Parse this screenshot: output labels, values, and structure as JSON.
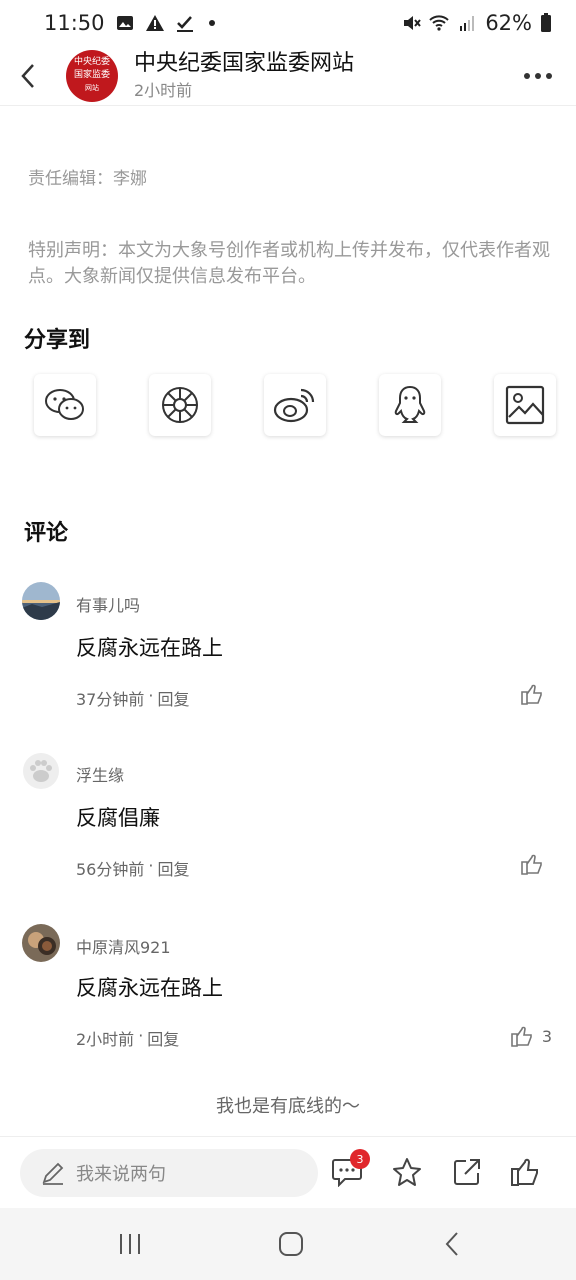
{
  "status_bar": {
    "time": "11:50",
    "battery": "62%"
  },
  "header": {
    "title": "中央纪委国家监委网站",
    "time": "2小时前",
    "logo_text": [
      "中央纪委",
      "国家监委",
      "网站"
    ]
  },
  "article": {
    "editor": "责任编辑：李娜",
    "disclaimer": "特别声明：本文为大象号创作者或机构上传并发布，仅代表作者观点。大象新闻仅提供信息发布平台。"
  },
  "share": {
    "title": "分享到",
    "targets": [
      "wechat-icon",
      "moments-icon",
      "weibo-icon",
      "qq-icon",
      "image-icon"
    ]
  },
  "comments": {
    "title": "评论",
    "items": [
      {
        "user": "有事儿吗",
        "text": "反腐永远在路上",
        "time": "37分钟前",
        "reply": "回复",
        "likes": ""
      },
      {
        "user": "浮生缘",
        "text": "反腐倡廉",
        "time": "56分钟前",
        "reply": "回复",
        "likes": ""
      },
      {
        "user": "中原清风921",
        "text": "反腐永远在路上",
        "time": "2小时前",
        "reply": "回复",
        "likes": "3"
      }
    ],
    "end_note": "我也是有底线的～"
  },
  "bottom_bar": {
    "input_placeholder": "我来说两句",
    "comment_badge": "3"
  },
  "colors": {
    "accent_red": "#e0262b",
    "logo_red": "#c0181d"
  }
}
